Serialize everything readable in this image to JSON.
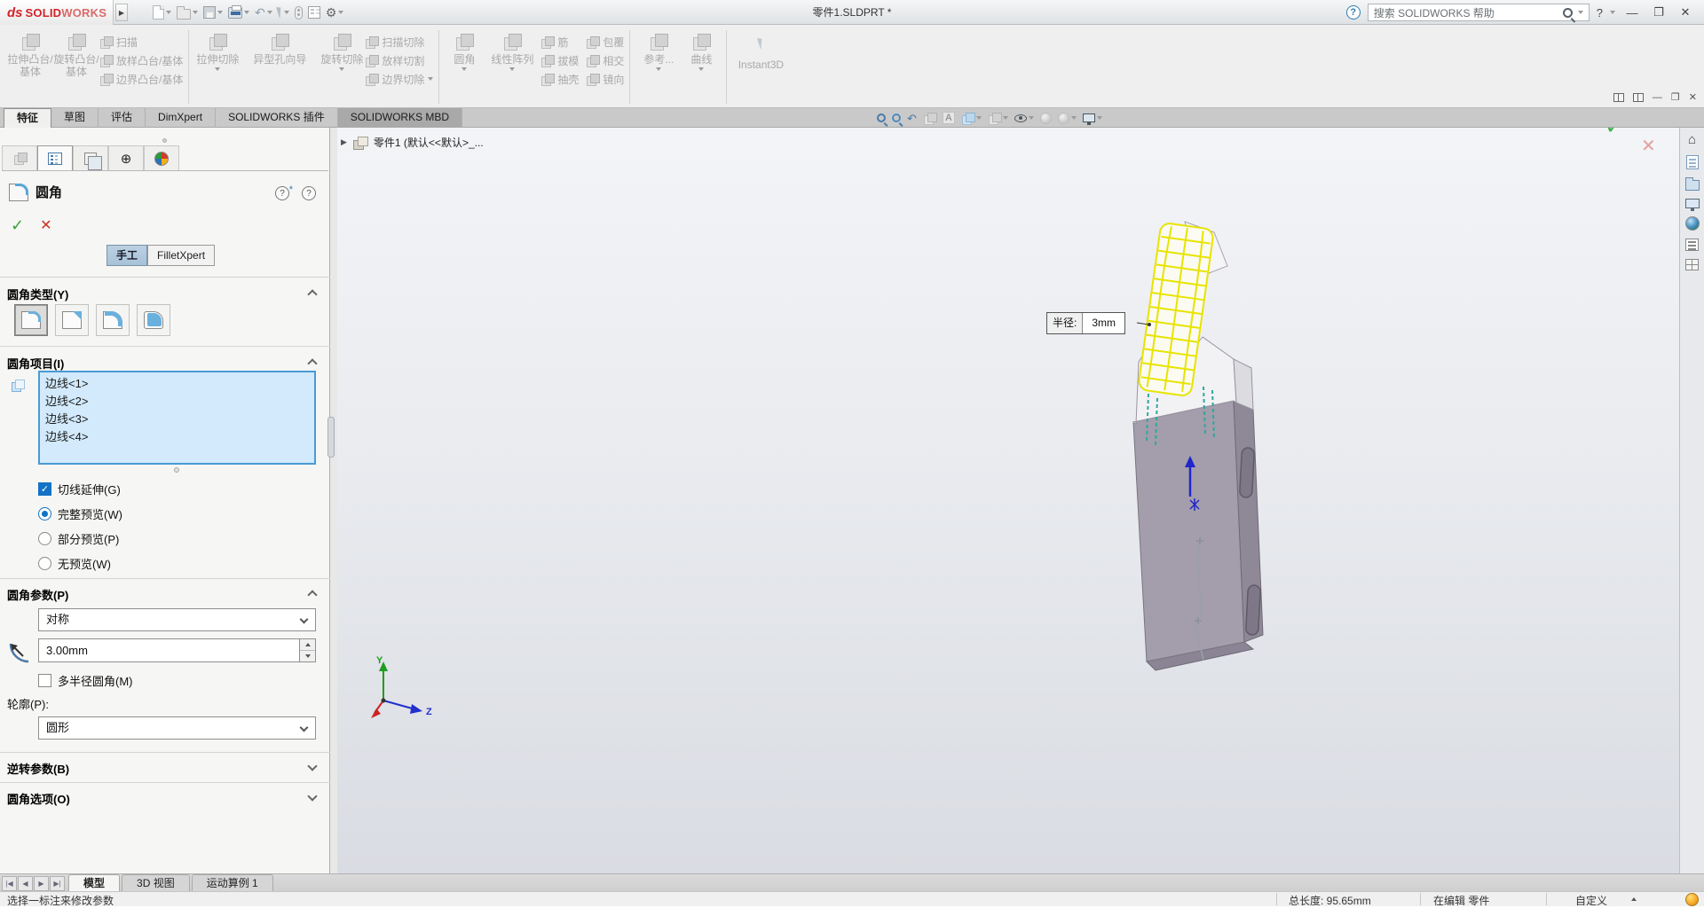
{
  "window": {
    "doc_title": "零件1.SLDPRT *",
    "brand_ds": "ds",
    "brand_solid": "SOLID",
    "brand_works": "WORKS",
    "search_placeholder": "搜索 SOLIDWORKS 帮助",
    "help_mark": "?"
  },
  "icons": {
    "expand_arrow": "▶",
    "undo": "↶",
    "gear": "⚙",
    "minimize": "—",
    "restore": "❐",
    "close": "✕",
    "check": "✓",
    "cross": "✕",
    "prev_view": "↶",
    "annotation_a": "A",
    "home": "⌂",
    "nav_first": "|◀",
    "nav_prev": "◀",
    "nav_next": "▶",
    "nav_last": "▶|",
    "flyout_arrow": "▶"
  },
  "ribbon": {
    "groups": [
      {
        "big": [
          {
            "label": "拉伸凸台/基体"
          },
          {
            "label": "旋转凸台/基体"
          }
        ],
        "stack": [
          "扫描",
          "放样凸台/基体",
          "边界凸台/基体"
        ]
      },
      {
        "big": [
          {
            "label": "拉伸切除"
          },
          {
            "label": "异型孔向导"
          },
          {
            "label": "旋转切除"
          }
        ],
        "stack": [
          "扫描切除",
          "放样切割",
          "边界切除"
        ]
      },
      {
        "big": [
          {
            "label": "圆角"
          },
          {
            "label": "线性阵列"
          }
        ],
        "stack": [
          "筋",
          "拔模",
          "抽壳"
        ],
        "stack2": [
          "包覆",
          "相交",
          "镜向"
        ]
      },
      {
        "big": [
          {
            "label": "参考..."
          },
          {
            "label": "曲线"
          }
        ]
      },
      {
        "big": [
          {
            "label": "Instant3D"
          }
        ]
      }
    ]
  },
  "tabs": {
    "items": [
      "特征",
      "草图",
      "评估",
      "DimXpert",
      "SOLIDWORKS 插件",
      "SOLIDWORKS MBD"
    ],
    "active_index": 0
  },
  "panel": {
    "title": "圆角",
    "mode_manual": "手工",
    "mode_xpert": "FilletXpert",
    "fillet_type_header": "圆角类型(Y)",
    "items_header": "圆角项目(I)",
    "edges": [
      "边线<1>",
      "边线<2>",
      "边线<3>",
      "边线<4>"
    ],
    "tangent_label": "切线延伸(G)",
    "preview_full": "完整预览(W)",
    "preview_partial": "部分预览(P)",
    "preview_none": "无预览(W)",
    "params_header": "圆角参数(P)",
    "symmetry_value": "对称",
    "radius_value": "3.00mm",
    "multi_radius_label": "多半径圆角(M)",
    "profile_label": "轮廓(P):",
    "profile_value": "圆形",
    "setback_header": "逆转参数(B)",
    "options_header": "圆角选项(O)"
  },
  "viewport": {
    "flyout_tree": "零件1 (默认<<默认>_...",
    "callout_label": "半径:",
    "callout_value": "3mm",
    "axis_y": "Y",
    "axis_z": "Z"
  },
  "bottom": {
    "model_tabs": [
      "模型",
      "3D 视图",
      "运动算例 1"
    ],
    "active_index": 0,
    "hint": "选择一标注来修改参数",
    "total_length": "总长度: 95.65mm",
    "editing": "在编辑 零件",
    "custom": "自定义"
  },
  "colors": {
    "accent_blue": "#2f7cbe",
    "selection_fill": "#d2eafb",
    "preview_yellow": "#e8e400",
    "part_grey": "#a49dab",
    "check_green": "#44b04c",
    "cross_red": "#e4a0a0",
    "brand_red": "#d2232a"
  }
}
